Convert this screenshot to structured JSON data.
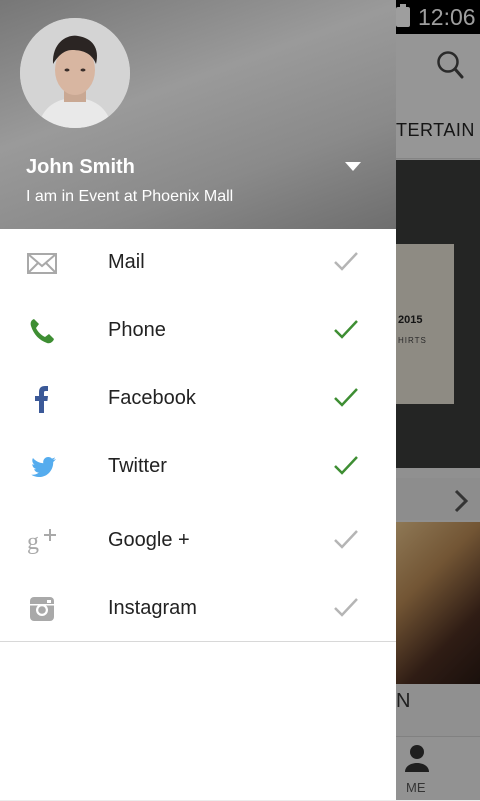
{
  "status_bar": {
    "time": "12:06"
  },
  "background_app": {
    "tab_partial": "TERTAIN",
    "poster_year": "2015",
    "poster_sub": "HIRTS",
    "list_partial": "N",
    "bottom_nav_label": "ME"
  },
  "profile": {
    "name": "John Smith",
    "status": "I am in Event at Phoenix Mall"
  },
  "menu": {
    "items": [
      {
        "label": "Mail",
        "icon": "mail-icon",
        "enabled": false
      },
      {
        "label": "Phone",
        "icon": "phone-icon",
        "enabled": true
      },
      {
        "label": "Facebook",
        "icon": "facebook-icon",
        "enabled": true
      },
      {
        "label": "Twitter",
        "icon": "twitter-icon",
        "enabled": true
      },
      {
        "label": "Google +",
        "icon": "google-plus-icon",
        "enabled": false
      },
      {
        "label": "Instagram",
        "icon": "instagram-icon",
        "enabled": false
      }
    ]
  },
  "colors": {
    "check_on": "#3e8e33",
    "check_off": "#b5b5b5",
    "phone": "#3e8e33",
    "facebook": "#3b5998",
    "twitter": "#55acee",
    "muted_icon": "#a9a9a9"
  }
}
